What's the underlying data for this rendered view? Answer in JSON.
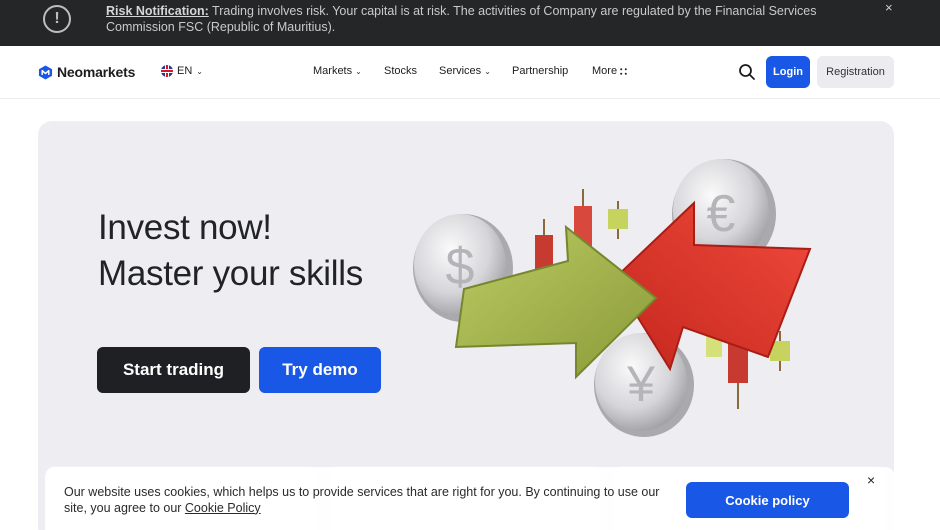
{
  "risk_banner": {
    "title": "Risk Notification:",
    "text": " Trading involves risk. Your capital is at risk. The activities of Company are regulated by the Financial Services Commission FSC (Republic of Mauritius).",
    "icon": "exclamation-circle-icon",
    "close": "×"
  },
  "header": {
    "brand": "Neomarkets",
    "language": "EN",
    "nav": [
      {
        "label": "Markets",
        "dropdown": true
      },
      {
        "label": "Stocks",
        "dropdown": false
      },
      {
        "label": "Services",
        "dropdown": true
      },
      {
        "label": "Partnership",
        "dropdown": false
      },
      {
        "label": "More",
        "dropdown": true
      }
    ],
    "login": "Login",
    "registration": "Registration"
  },
  "hero": {
    "title_line1": "Invest now!",
    "title_line2": "Master your skills",
    "start_trading": "Start trading",
    "try_demo": "Try demo"
  },
  "cookie": {
    "text": "Our website uses cookies, which helps us to provide services that are right for you. By continuing to use our site, you agree to our ",
    "link": "Cookie Policy",
    "button": "Cookie policy",
    "close": "×"
  },
  "colors": {
    "accent": "#1958e6",
    "banner_bg": "#242628",
    "hero_bg": "#ededf2",
    "dark_button": "#1f2023",
    "arrow_green": "#a7b84e",
    "arrow_red": "#e53a30"
  }
}
